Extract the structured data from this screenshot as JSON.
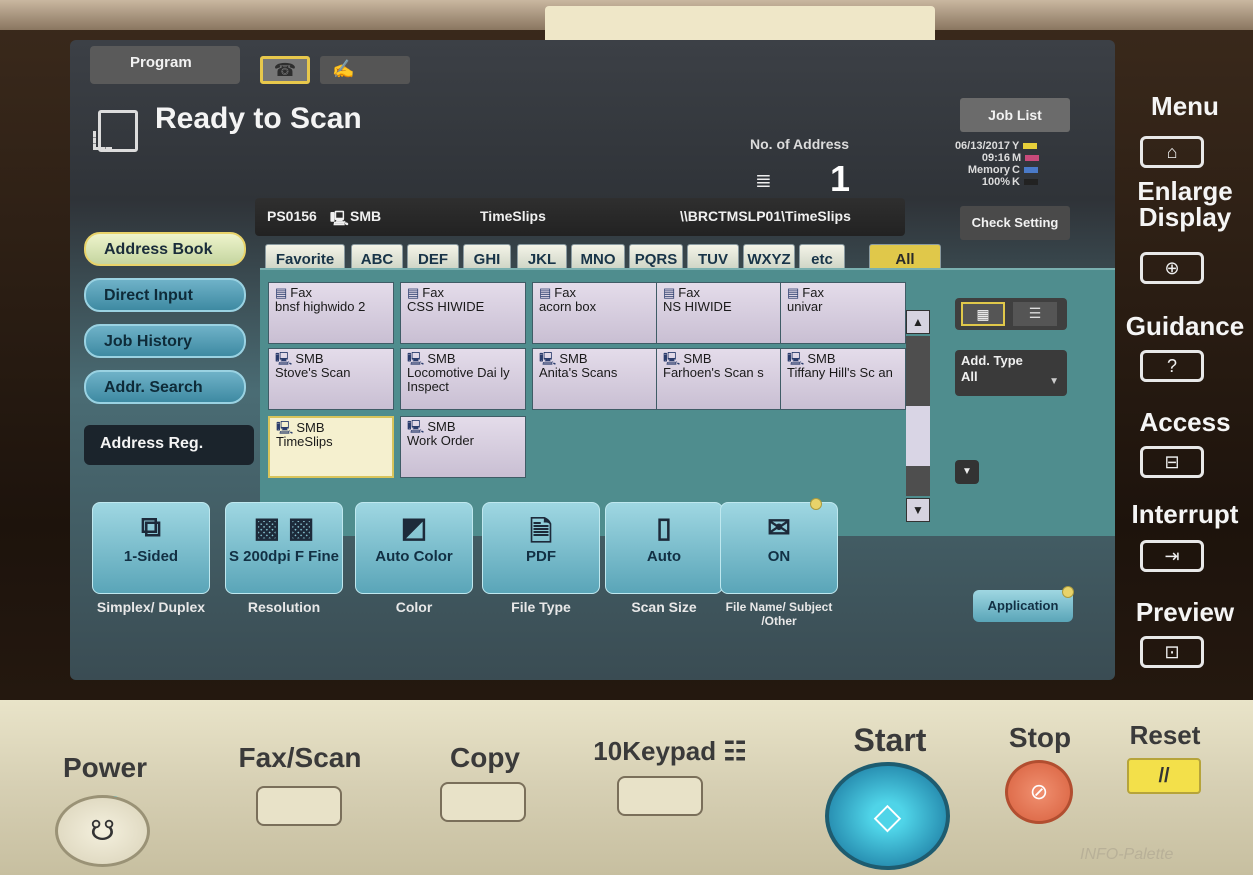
{
  "header": {
    "program_tab": "Program",
    "fax_icon": "fax-icon",
    "pen_icon": "pen-icon",
    "status_title": "Ready to Scan",
    "job_list": "Job List",
    "no_of_address_label": "No. of Address",
    "no_of_address_value": "1",
    "date": "06/13/2017",
    "time": "09:16",
    "memory_label": "Memory",
    "memory_value": "100%",
    "toner": [
      {
        "label": "Y",
        "color": "#e6cf3a"
      },
      {
        "label": "M",
        "color": "#c84a7a"
      },
      {
        "label": "C",
        "color": "#4a7ac8"
      },
      {
        "label": "K",
        "color": "#222222"
      }
    ],
    "check_setting": "Check Setting"
  },
  "destination": {
    "code": "PS0156",
    "type": "SMB",
    "name": "TimeSlips",
    "path": "\\\\BRCTMSLP01\\TimeSlips"
  },
  "side_tabs": [
    "Address Book",
    "Direct Input",
    "Job History",
    "Addr. Search"
  ],
  "address_reg": "Address Reg.",
  "index_tabs": [
    "Favorite",
    "ABC",
    "DEF",
    "GHI",
    "JKL",
    "MNO",
    "PQRS",
    "TUV",
    "WXYZ",
    "etc",
    "All"
  ],
  "addresses": [
    {
      "type": "Fax",
      "name": "bnsf highwido 2"
    },
    {
      "type": "Fax",
      "name": "CSS HIWIDE"
    },
    {
      "type": "Fax",
      "name": "acorn box"
    },
    {
      "type": "Fax",
      "name": "NS HIWIDE"
    },
    {
      "type": "Fax",
      "name": "univar"
    },
    {
      "type": "SMB",
      "name": "Stove's Scan"
    },
    {
      "type": "SMB",
      "name": "Locomotive Dai ly Inspect"
    },
    {
      "type": "SMB",
      "name": "Anita's Scans"
    },
    {
      "type": "SMB",
      "name": "Farhoen's Scan s"
    },
    {
      "type": "SMB",
      "name": "Tiffany Hill's Sc an"
    },
    {
      "type": "SMB",
      "name": "TimeSlips"
    },
    {
      "type": "SMB",
      "name": "Work Order"
    }
  ],
  "add_type": {
    "label": "Add. Type",
    "value": "All"
  },
  "functions": [
    {
      "value": "1-Sided",
      "caption": "Simplex/ Duplex",
      "icon": "duplex-icon"
    },
    {
      "value": "S 200dpi F Fine",
      "caption": "Resolution",
      "icon": "resolution-icon"
    },
    {
      "value": "Auto Color",
      "caption": "Color",
      "icon": "color-icon"
    },
    {
      "value": "PDF",
      "caption": "File Type",
      "icon": "pdf-icon"
    },
    {
      "value": "Auto",
      "caption": "Scan Size",
      "icon": "page-icon"
    },
    {
      "value": "ON",
      "caption": "File Name/ Subject /Other",
      "icon": "mail-icon"
    }
  ],
  "application": "Application",
  "hw_keys": [
    {
      "label": "Menu",
      "icon": "home-icon"
    },
    {
      "label": "Enlarge Display",
      "icon": "zoom-icon"
    },
    {
      "label": "Guidance",
      "icon": "help-icon"
    },
    {
      "label": "Access",
      "icon": "access-icon"
    },
    {
      "label": "Interrupt",
      "icon": "interrupt-icon"
    },
    {
      "label": "Preview",
      "icon": "preview-icon"
    }
  ],
  "panel": {
    "power": "Power",
    "fax_scan": "Fax/Scan",
    "copy": "Copy",
    "keypad": "10Keypad",
    "start": "Start",
    "stop": "Stop",
    "reset": "Reset",
    "reset_symbol": "//",
    "brand": "INFO-Palette"
  }
}
